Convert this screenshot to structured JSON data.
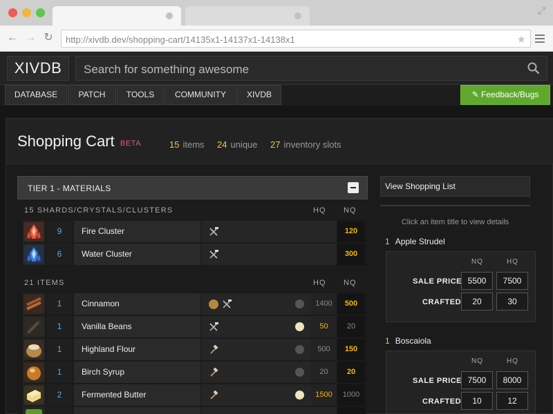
{
  "browser": {
    "url": "http://xivdb.dev/shopping-cart/14135x1-14137x1-14138x1"
  },
  "site": {
    "logo": "XIVDB",
    "search_placeholder": "Search for something awesome",
    "nav": [
      {
        "label": "DATABASE"
      },
      {
        "label": "PATCH"
      },
      {
        "label": "TOOLS"
      },
      {
        "label": "COMMUNITY"
      },
      {
        "label": "XIVDB"
      }
    ],
    "feedback_label": "Feedback/Bugs"
  },
  "page": {
    "title": "Shopping Cart",
    "beta": "BETA",
    "stats": [
      {
        "value": "15",
        "label": "items"
      },
      {
        "value": "24",
        "label": "unique"
      },
      {
        "value": "27",
        "label": "inventory slots"
      }
    ]
  },
  "tier": {
    "label": "TIER 1 - MATERIALS",
    "sections": [
      {
        "label": "15 SHARDS/CRYSTALS/CLUSTERS",
        "hq_label": "HQ",
        "nq_label": "NQ",
        "rows": [
          {
            "qty": "9",
            "name": "Fire Cluster",
            "hq": "",
            "nq": "120",
            "nq_style": "hl",
            "icon": "fire-cluster"
          },
          {
            "qty": "6",
            "name": "Water Cluster",
            "hq": "",
            "nq": "300",
            "nq_style": "hl",
            "icon": "water-cluster"
          }
        ]
      },
      {
        "label": "21 ITEMS",
        "hq_label": "HQ",
        "nq_label": "NQ",
        "rows": [
          {
            "qty": "1",
            "name": "Cinnamon",
            "hq": "1400",
            "nq": "500",
            "hq_style": "dim",
            "nq_style": "hl",
            "icon": "cinnamon"
          },
          {
            "qty": "1",
            "name": "Vanilla Beans",
            "hq": "50",
            "nq": "20",
            "hq_style": "hl",
            "nq_style": "dim",
            "icon": "vanilla-beans"
          },
          {
            "qty": "1",
            "name": "Highland Flour",
            "hq": "500",
            "nq": "150",
            "hq_style": "dim",
            "nq_style": "hl",
            "icon": "highland-flour"
          },
          {
            "qty": "1",
            "name": "Birch Syrup",
            "hq": "20",
            "nq": "20",
            "hq_style": "dim",
            "nq_style": "hl",
            "icon": "birch-syrup"
          },
          {
            "qty": "2",
            "name": "Fermented Butter",
            "hq": "1500",
            "nq": "1000",
            "hq_style": "hl",
            "nq_style": "dim",
            "icon": "fermented-butter"
          }
        ]
      }
    ]
  },
  "right": {
    "view_label": "View Shopping List",
    "hint": "Click an item title to view details",
    "recipes": [
      {
        "qty": "1",
        "name": "Apple Strudel",
        "col1": "NQ",
        "col2": "HQ",
        "sale_label": "SALE PRICE",
        "crafted_label": "CRAFTED",
        "sale1": "5500",
        "sale2": "7500",
        "craft1": "20",
        "craft2": "30"
      },
      {
        "qty": "1",
        "name": "Boscaiola",
        "col1": "NQ",
        "col2": "HQ",
        "sale_label": "SALE PRICE",
        "crafted_label": "CRAFTED",
        "sale1": "7500",
        "sale2": "8000",
        "craft1": "10",
        "craft2": "12"
      }
    ]
  },
  "colors": {
    "accent_green": "#5fa82d",
    "highlight_gold": "#f3b900",
    "qty_blue": "#5aa9e6",
    "beta_pink": "#e0559a"
  }
}
